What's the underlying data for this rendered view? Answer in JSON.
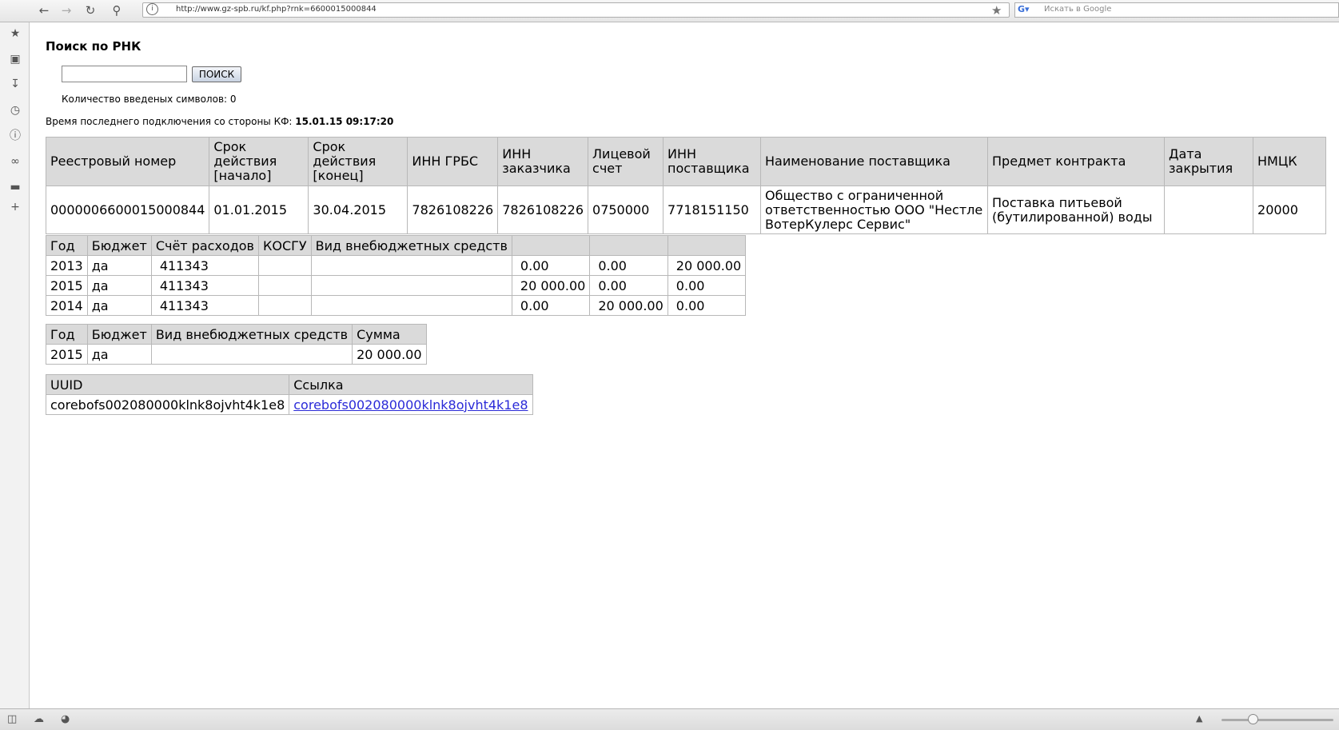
{
  "browser": {
    "url": "http://www.gz-spb.ru/kf.php?rnk=6600015000844",
    "search_placeholder": "Искать в Google"
  },
  "page": {
    "heading": "Поиск по РНК",
    "search_button": "ПОИСК",
    "char_count_text": "Количество введеных символов: 0",
    "last_connection_label": "Время последнего подключения со стороны КФ:",
    "last_connection_value": "15.01.15 09:17:20"
  },
  "main_table": {
    "headers": [
      "Реестровый номер",
      "Срок действия [начало]",
      "Срок действия [конец]",
      "ИНН ГРБС",
      "ИНН заказчика",
      "Лицевой счет",
      "ИНН поставщика",
      "Наименование поставщика",
      "Предмет контракта",
      "Дата закрытия",
      "НМЦК"
    ],
    "row": [
      "0000006600015000844",
      "01.01.2015",
      "30.04.2015",
      "7826108226",
      "7826108226",
      "0750000",
      "7718151150",
      "Общество с ограниченной ответственностью ООО \"Нестле ВотерКулерс Сервис\"",
      "Поставка питьевой (бутилированной) воды",
      "",
      "20000"
    ]
  },
  "years_table": {
    "headers": [
      "Год",
      "Бюджет",
      "Счёт расходов",
      "КОСГУ",
      "Вид внебюджетных средств",
      "",
      "",
      ""
    ],
    "rows": [
      [
        "2013",
        "да",
        "411343",
        "",
        "",
        "0.00",
        "0.00",
        "20 000.00"
      ],
      [
        "2015",
        "да",
        "411343",
        "",
        "",
        "20 000.00",
        "0.00",
        "0.00"
      ],
      [
        "2014",
        "да",
        "411343",
        "",
        "",
        "0.00",
        "20 000.00",
        "0.00"
      ]
    ]
  },
  "budget_table": {
    "headers": [
      "Год",
      "Бюджет",
      "Вид внебюджетных средств",
      "Сумма"
    ],
    "rows": [
      [
        "2015",
        "да",
        "",
        "20 000.00"
      ]
    ]
  },
  "uuid_table": {
    "headers": [
      "UUID",
      "Ссылка"
    ],
    "rows": [
      [
        "corebofs002080000klnk8ojvht4k1e8",
        "corebofs002080000klnk8ojvht4k1e8"
      ]
    ]
  }
}
